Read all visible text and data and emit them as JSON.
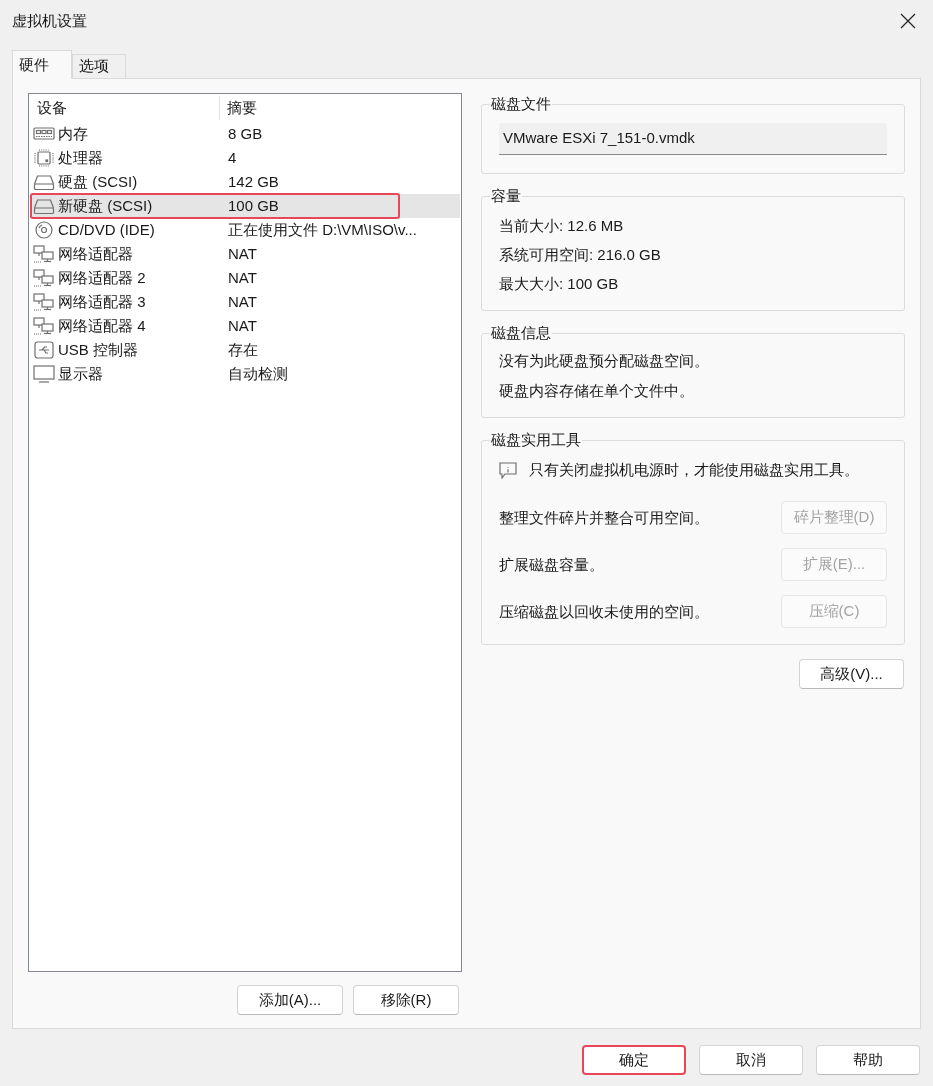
{
  "window": {
    "title": "虚拟机设置"
  },
  "tabs": [
    {
      "label": "硬件",
      "selected": true
    },
    {
      "label": "选项",
      "selected": false
    }
  ],
  "device_list": {
    "columns": [
      "设备",
      "摘要"
    ],
    "rows": [
      {
        "kind": "memory",
        "device": "内存",
        "summary": "8 GB",
        "selected": false,
        "highlighted": false
      },
      {
        "kind": "processor",
        "device": "处理器",
        "summary": "4",
        "selected": false,
        "highlighted": false
      },
      {
        "kind": "disk",
        "device": "硬盘 (SCSI)",
        "summary": "142 GB",
        "selected": false,
        "highlighted": false
      },
      {
        "kind": "disk",
        "device": "新硬盘 (SCSI)",
        "summary": "100 GB",
        "selected": true,
        "highlighted": true
      },
      {
        "kind": "cdrom",
        "device": "CD/DVD (IDE)",
        "summary": "正在使用文件 D:\\VM\\ISO\\v...",
        "selected": false,
        "highlighted": false
      },
      {
        "kind": "network",
        "device": "网络适配器",
        "summary": "NAT",
        "selected": false,
        "highlighted": false
      },
      {
        "kind": "network",
        "device": "网络适配器 2",
        "summary": "NAT",
        "selected": false,
        "highlighted": false
      },
      {
        "kind": "network",
        "device": "网络适配器 3",
        "summary": "NAT",
        "selected": false,
        "highlighted": false
      },
      {
        "kind": "network",
        "device": "网络适配器 4",
        "summary": "NAT",
        "selected": false,
        "highlighted": false
      },
      {
        "kind": "usb",
        "device": "USB 控制器",
        "summary": "存在",
        "selected": false,
        "highlighted": false
      },
      {
        "kind": "display",
        "device": "显示器",
        "summary": "自动检测",
        "selected": false,
        "highlighted": false
      }
    ]
  },
  "list_buttons": [
    "添加(A)...",
    "移除(R)"
  ],
  "disk_file": {
    "title": "磁盘文件",
    "value": "VMware ESXi 7_151-0.vmdk"
  },
  "capacity": {
    "title": "容量",
    "lines": [
      "当前大小: 12.6 MB",
      "系统可用空间: 216.0 GB",
      "最大大小: 100 GB"
    ]
  },
  "disk_info": {
    "title": "磁盘信息",
    "lines": [
      "没有为此硬盘预分配磁盘空间。",
      "硬盘内容存储在单个文件中。"
    ]
  },
  "disk_utilities": {
    "title": "磁盘实用工具",
    "notice": "只有关闭虚拟机电源时，才能使用磁盘实用工具。",
    "actions": [
      {
        "description": "整理文件碎片并整合可用空间。",
        "button": "碎片整理(D)",
        "disabled": true
      },
      {
        "description": "扩展磁盘容量。",
        "button": "扩展(E)...",
        "disabled": true
      },
      {
        "description": "压缩磁盘以回收未使用的空间。",
        "button": "压缩(C)",
        "disabled": true
      }
    ]
  },
  "advanced_button": "高级(V)...",
  "dialog_buttons": [
    {
      "label": "确定",
      "highlighted": true
    },
    {
      "label": "取消",
      "highlighted": false
    },
    {
      "label": "帮助",
      "highlighted": false
    }
  ]
}
